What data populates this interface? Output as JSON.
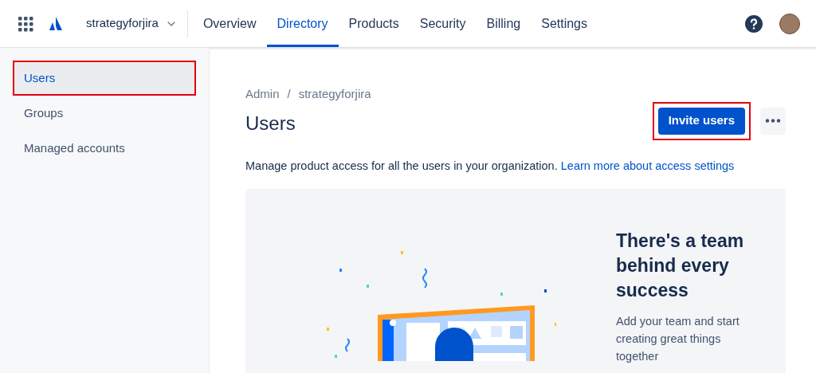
{
  "header": {
    "org": "strategyforjira",
    "tabs": [
      {
        "label": "Overview",
        "selected": false
      },
      {
        "label": "Directory",
        "selected": true
      },
      {
        "label": "Products",
        "selected": false
      },
      {
        "label": "Security",
        "selected": false
      },
      {
        "label": "Billing",
        "selected": false
      },
      {
        "label": "Settings",
        "selected": false
      }
    ]
  },
  "sidebar": {
    "items": [
      {
        "label": "Users",
        "selected": true,
        "highlighted": true
      },
      {
        "label": "Groups",
        "selected": false,
        "highlighted": false
      },
      {
        "label": "Managed accounts",
        "selected": false,
        "highlighted": false
      }
    ]
  },
  "main": {
    "breadcrumb": [
      "Admin",
      "strategyforjira"
    ],
    "breadcrumb_separator": "/",
    "title": "Users",
    "invite_button": {
      "label": "Invite users",
      "highlighted": true
    },
    "description": "Manage product access for all the users in your organization.",
    "link": "Learn more about access settings",
    "promo": {
      "heading": "There's a team behind every success",
      "text": "Add your team and start creating great things together"
    }
  }
}
